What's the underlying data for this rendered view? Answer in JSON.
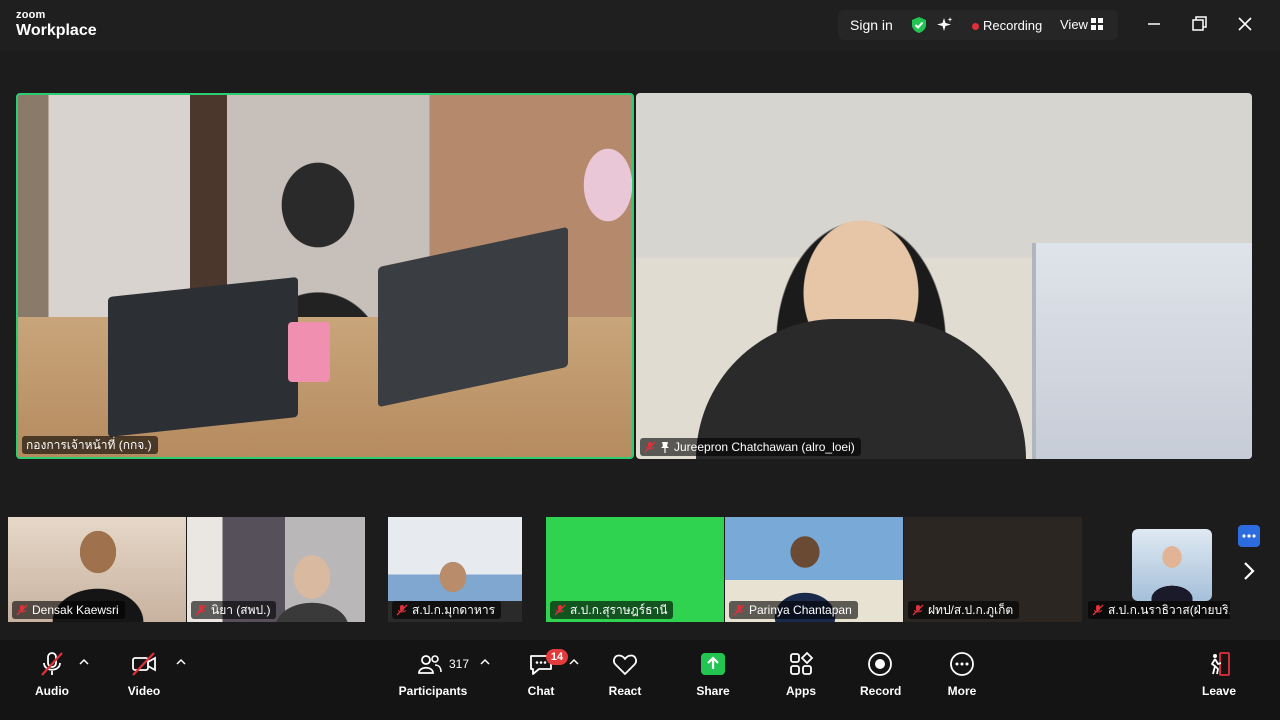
{
  "app": {
    "brand_top": "zoom",
    "brand_bottom": "Workplace"
  },
  "titlebar": {
    "sign_in": "Sign in",
    "recording": "Recording",
    "view": "View"
  },
  "speakers": [
    {
      "name": "กองการเจ้าหน้าที่ (กกจ.)",
      "muted": false
    },
    {
      "name": "Jureepron Chatchawan (alro_loei)",
      "muted": true,
      "pinned": true
    }
  ],
  "strip": [
    {
      "name": "Densak Kaewsri"
    },
    {
      "name": "นิยา  (สพป.)"
    },
    {
      "name": "ส.ป.ก.มุกดาหาร"
    },
    {
      "name": "ส.ป.ก.สุราษฎร์ธานี"
    },
    {
      "name": "Parinya Chantapan"
    },
    {
      "name": "ฝทป/ส.ป.ก.ภูเก็ต"
    },
    {
      "name": "ส.ป.ก.นราธิวาส(ฝ่ายบริ..."
    }
  ],
  "toolbar": {
    "audio": "Audio",
    "video": "Video",
    "participants": "Participants",
    "participants_count": "317",
    "chat": "Chat",
    "chat_badge": "14",
    "react": "React",
    "share": "Share",
    "apps": "Apps",
    "record": "Record",
    "more": "More",
    "leave": "Leave"
  },
  "colors": {
    "active_speaker_border": "#2ecc71",
    "share_green": "#23c552",
    "muted_red": "#e0303a",
    "leave_red": "#e0303a"
  }
}
